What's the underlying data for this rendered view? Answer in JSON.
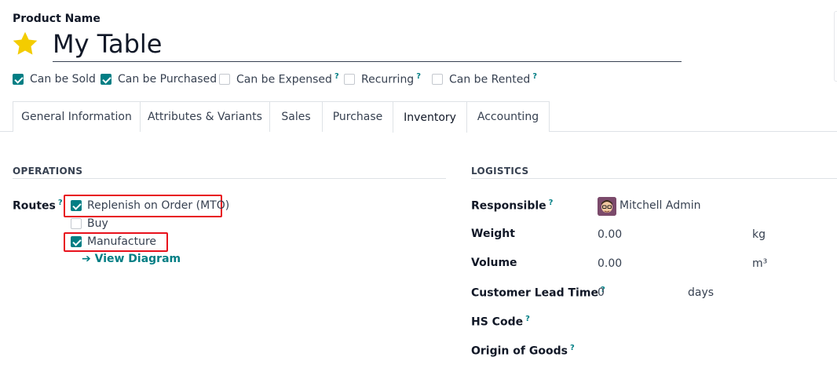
{
  "product": {
    "name_label": "Product Name",
    "name": "My Table"
  },
  "flags": [
    {
      "label": "Can be Sold",
      "checked": true,
      "help": ""
    },
    {
      "label": "Can be Purchased",
      "checked": true,
      "help": ""
    },
    {
      "label": "Can be Expensed",
      "checked": false,
      "help": "?"
    },
    {
      "label": "Recurring",
      "checked": false,
      "help": "?"
    },
    {
      "label": "Can be Rented",
      "checked": false,
      "help": "?"
    }
  ],
  "tabs": [
    "General Information",
    "Attributes & Variants",
    "Sales",
    "Purchase",
    "Inventory",
    "Accounting"
  ],
  "active_tab": "Inventory",
  "operations": {
    "title": "OPERATIONS",
    "routes_label": "Routes",
    "routes_help": "?",
    "routes": [
      {
        "label": "Replenish on Order (MTO)",
        "checked": true
      },
      {
        "label": "Buy",
        "checked": false
      },
      {
        "label": "Manufacture",
        "checked": true
      }
    ],
    "view_diagram": "➔ View Diagram"
  },
  "logistics": {
    "title": "LOGISTICS",
    "responsible_label": "Responsible",
    "responsible_help": "?",
    "responsible_value": "Mitchell Admin",
    "weight_label": "Weight",
    "weight_value": "0.00",
    "weight_unit": "kg",
    "volume_label": "Volume",
    "volume_value": "0.00",
    "volume_unit": "m³",
    "lead_time_label": "Customer Lead Time",
    "lead_time_help": "?",
    "lead_time_value": "0",
    "lead_time_unit": "days",
    "hs_code_label": "HS Code",
    "hs_code_help": "?",
    "origin_label": "Origin of Goods",
    "origin_help": "?"
  },
  "colors": {
    "accent": "#017e84",
    "highlight": "#e8111c",
    "star": "#f3cc00"
  }
}
